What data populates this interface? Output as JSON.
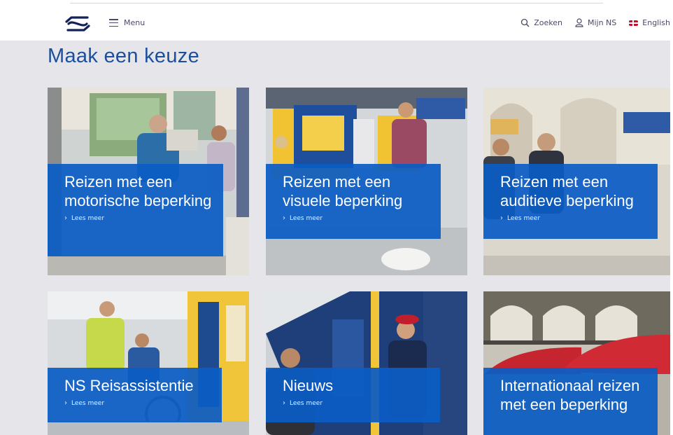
{
  "header": {
    "logo_name": "ns-logo",
    "menu_label": "Menu",
    "search_label": "Zoeken",
    "account_label": "Mijn NS",
    "language_label": "English"
  },
  "page": {
    "title": "Maak een keuze"
  },
  "colors": {
    "brand_blue": "#0b5cc4",
    "title_blue": "#1b4f9e",
    "background": "#e6e6ea"
  },
  "tiles": [
    {
      "title": "Reizen met een motorische beperking",
      "link": "Lees meer"
    },
    {
      "title": "Reizen met een visuele beperking",
      "link": "Lees meer"
    },
    {
      "title": "Reizen met een auditieve beperking",
      "link": "Lees meer"
    },
    {
      "title": "NS Reisassistentie",
      "link": "Lees meer"
    },
    {
      "title": "Nieuws",
      "link": "Lees meer"
    },
    {
      "title": "Internationaal reizen met een beperking",
      "link": ""
    }
  ]
}
